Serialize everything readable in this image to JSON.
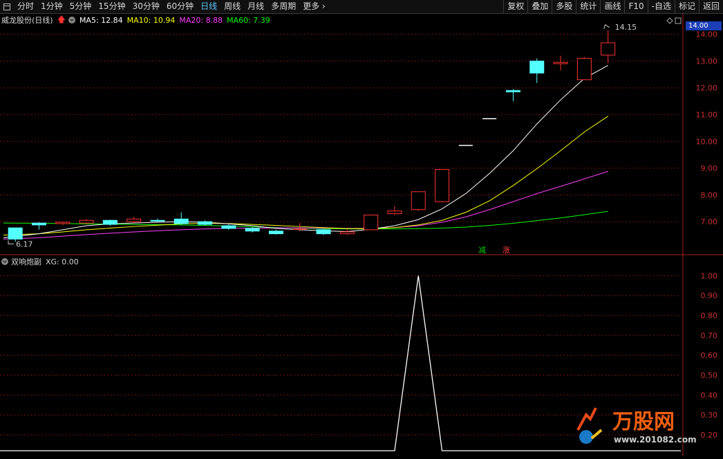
{
  "toolbar": {
    "left_items": [
      "分时",
      "1分钟",
      "5分钟",
      "15分钟",
      "30分钟",
      "60分钟",
      "日线",
      "周线",
      "月线",
      "多周期",
      "更多"
    ],
    "active_item": "日线",
    "right_buttons": [
      "复权",
      "叠加",
      "多股",
      "统计",
      "画线",
      "F10",
      "-自选",
      "标记",
      "返回"
    ]
  },
  "main_chart": {
    "stock_title": "威龙股份(日线)",
    "ma_labels": [
      {
        "text": "MA5: 12.84",
        "color": "#ffffff"
      },
      {
        "text": "MA10: 10.94",
        "color": "#ffff00"
      },
      {
        "text": "MA20: 8.88",
        "color": "#ff40ff"
      },
      {
        "text": "MA60: 7.39",
        "color": "#00ff00"
      }
    ],
    "y_ticks": [
      "14.00",
      "13.00",
      "12.00",
      "11.00",
      "10.00",
      "9.00",
      "8.00",
      "7.00"
    ],
    "current_price_box": "14.00",
    "high_marker": "14.15",
    "low_marker": "6.17",
    "tags": [
      {
        "text": "减",
        "color": "#00d000"
      },
      {
        "text": "涨",
        "color": "#ff4040"
      }
    ]
  },
  "sub_chart": {
    "title": "双响炮副",
    "xg_label": "XG: 0.00",
    "y_ticks": [
      "1.00",
      "0.90",
      "0.80",
      "0.70",
      "0.60",
      "0.50",
      "0.40",
      "0.30",
      "0.20"
    ]
  },
  "chart_data": {
    "type": "candlestick",
    "ylim": [
      6.0,
      14.3
    ],
    "candles": [
      {
        "o": 6.77,
        "c": 6.35,
        "h": 6.77,
        "l": 6.25
      },
      {
        "o": 6.95,
        "c": 6.88,
        "h": 6.98,
        "l": 6.7
      },
      {
        "o": 6.93,
        "c": 6.98,
        "h": 7.0,
        "l": 6.88
      },
      {
        "o": 6.95,
        "c": 7.05,
        "h": 7.1,
        "l": 6.9
      },
      {
        "o": 7.05,
        "c": 6.9,
        "h": 7.08,
        "l": 6.85
      },
      {
        "o": 7.0,
        "c": 7.1,
        "h": 7.18,
        "l": 6.95
      },
      {
        "o": 7.05,
        "c": 7.02,
        "h": 7.12,
        "l": 6.98
      },
      {
        "o": 7.1,
        "c": 6.93,
        "h": 7.35,
        "l": 6.88
      },
      {
        "o": 7.0,
        "c": 6.9,
        "h": 7.05,
        "l": 6.85
      },
      {
        "o": 6.85,
        "c": 6.75,
        "h": 6.9,
        "l": 6.7
      },
      {
        "o": 6.75,
        "c": 6.65,
        "h": 6.8,
        "l": 6.6
      },
      {
        "o": 6.65,
        "c": 6.55,
        "h": 6.7,
        "l": 6.52
      },
      {
        "o": 6.7,
        "c": 6.72,
        "h": 6.95,
        "l": 6.65
      },
      {
        "o": 6.7,
        "c": 6.55,
        "h": 6.72,
        "l": 6.5
      },
      {
        "o": 6.55,
        "c": 6.62,
        "h": 6.7,
        "l": 6.5
      },
      {
        "o": 6.7,
        "c": 7.25,
        "h": 7.25,
        "l": 6.68
      },
      {
        "o": 7.3,
        "c": 7.4,
        "h": 7.58,
        "l": 7.25
      },
      {
        "o": 7.45,
        "c": 8.12,
        "h": 8.12,
        "l": 7.4
      },
      {
        "o": 7.75,
        "c": 8.95,
        "h": 8.95,
        "l": 7.72
      },
      {
        "o": 9.85,
        "c": 9.85,
        "h": 9.85,
        "l": 9.85
      },
      {
        "o": 10.85,
        "c": 10.85,
        "h": 10.85,
        "l": 10.85
      },
      {
        "o": 11.9,
        "c": 11.85,
        "h": 11.95,
        "l": 11.5
      },
      {
        "o": 13.0,
        "c": 12.55,
        "h": 13.1,
        "l": 12.18
      },
      {
        "o": 12.9,
        "c": 12.95,
        "h": 13.2,
        "l": 12.65
      },
      {
        "o": 12.3,
        "c": 13.1,
        "h": 13.15,
        "l": 12.3
      },
      {
        "o": 13.22,
        "c": 13.68,
        "h": 14.15,
        "l": 12.92
      }
    ],
    "ma5": [
      6.4,
      6.55,
      6.7,
      6.85,
      6.92,
      6.95,
      6.98,
      7.0,
      6.98,
      6.92,
      6.85,
      6.75,
      6.7,
      6.66,
      6.63,
      6.72,
      6.85,
      7.08,
      7.48,
      8.05,
      8.8,
      9.65,
      10.65,
      11.55,
      12.35,
      12.84
    ],
    "ma10": [
      6.5,
      6.55,
      6.62,
      6.7,
      6.76,
      6.82,
      6.87,
      6.92,
      6.94,
      6.93,
      6.9,
      6.86,
      6.82,
      6.78,
      6.74,
      6.74,
      6.78,
      6.88,
      7.05,
      7.35,
      7.78,
      8.35,
      8.98,
      9.65,
      10.35,
      10.94
    ],
    "ma20": [
      6.35,
      6.4,
      6.46,
      6.52,
      6.57,
      6.62,
      6.66,
      6.7,
      6.73,
      6.75,
      6.76,
      6.77,
      6.77,
      6.76,
      6.75,
      6.75,
      6.78,
      6.85,
      6.98,
      7.18,
      7.45,
      7.75,
      8.05,
      8.32,
      8.6,
      8.88
    ],
    "ma60": [
      6.95,
      6.94,
      6.93,
      6.92,
      6.91,
      6.9,
      6.89,
      6.88,
      6.86,
      6.84,
      6.81,
      6.78,
      6.76,
      6.74,
      6.73,
      6.73,
      6.73,
      6.74,
      6.76,
      6.8,
      6.86,
      6.94,
      7.04,
      7.14,
      7.26,
      7.39
    ],
    "xg": {
      "ylim": [
        0.12,
        1.05
      ],
      "peak_index": 17,
      "peak_value": 1.0
    }
  }
}
